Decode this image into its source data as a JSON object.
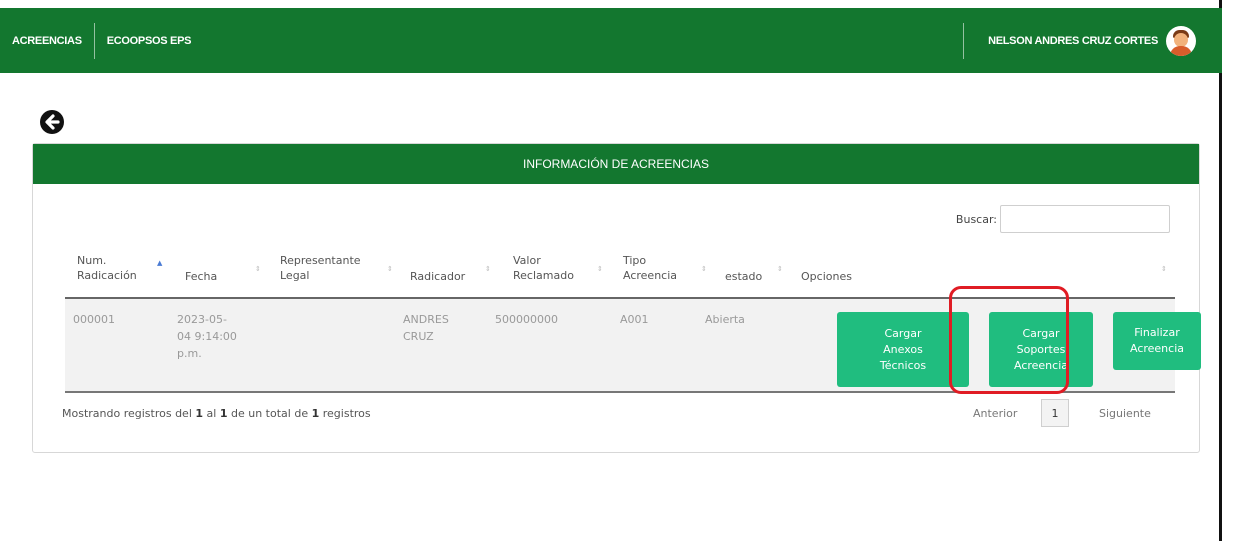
{
  "topbar": {
    "nav_primary": "ACREENCIAS",
    "nav_secondary": "ECOOPSOS EPS",
    "user_name": "NELSON ANDRES CRUZ CORTES"
  },
  "panel": {
    "title": "INFORMACIÓN DE ACREENCIAS",
    "search_label": "Buscar:",
    "search_value": ""
  },
  "table": {
    "columns": {
      "num_line1": "Num.",
      "num_line2": "Radicación",
      "fecha": "Fecha",
      "rep_line1": "Representante",
      "rep_line2": "Legal",
      "radicador": "Radicador",
      "valor_line1": "Valor",
      "valor_line2": "Reclamado",
      "tipo_line1": "Tipo",
      "tipo_line2": "Acreencia",
      "estado": "estado",
      "opciones": "Opciones"
    },
    "rows": [
      {
        "num": "000001",
        "fecha_line1": "2023-05-",
        "fecha_line2": "04 9:14:00",
        "fecha_line3": "p.m.",
        "representante": "",
        "radicador_line1": "ANDRES",
        "radicador_line2": "CRUZ",
        "valor": "500000000",
        "tipo": "A001",
        "estado": "Abierta",
        "btn_anexos": [
          "Cargar",
          "Anexos",
          "Técnicos"
        ],
        "btn_soportes": [
          "Cargar",
          "Soportes",
          "Acreencia"
        ],
        "btn_finalizar": [
          "Finalizar",
          "Acreencia"
        ]
      }
    ]
  },
  "footer": {
    "info_prefix": "Mostrando registros del ",
    "info_from": "1",
    "info_mid1": " al ",
    "info_to": "1",
    "info_mid2": " de un total de ",
    "info_total": "1",
    "info_suffix": " registros",
    "prev": "Anterior",
    "page": "1",
    "next": "Siguiente"
  },
  "colors": {
    "header_green": "#13772f",
    "button_green": "#20bd7f",
    "highlight_red": "#e01c24"
  },
  "icons": {
    "back": "arrow-left-circle-icon",
    "sort": "sort-arrows-icon",
    "avatar": "user-avatar-icon"
  }
}
